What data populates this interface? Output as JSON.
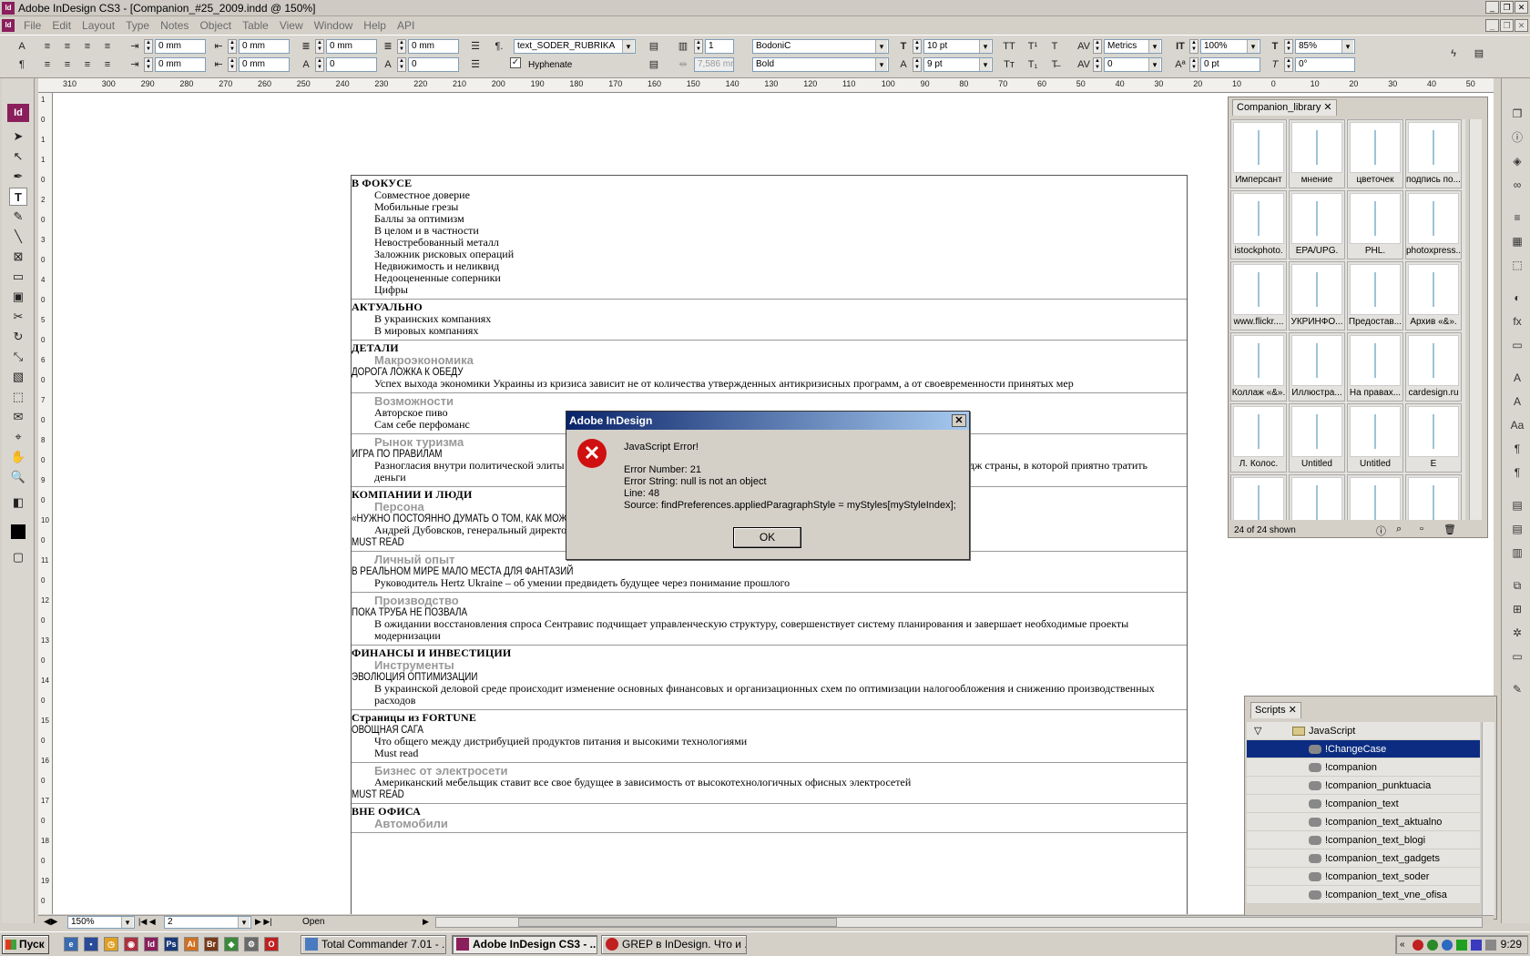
{
  "window": {
    "title": "Adobe InDesign CS3 - [Companion_#25_2009.indd @ 150%]",
    "app_icon": "Id"
  },
  "menu": [
    "File",
    "Edit",
    "Layout",
    "Type",
    "Notes",
    "Object",
    "Table",
    "View",
    "Window",
    "Help",
    "API"
  ],
  "control": {
    "indent_left": "0 mm",
    "indent_right": "0 mm",
    "first_line": "0 mm",
    "last_line": "0 mm",
    "space_before": "0 mm",
    "space_after": "0",
    "drop_lines": "0 mm",
    "drop_chars": "0",
    "paragraph_style": "text_SODER_RUBRIKA",
    "hyphenate_label": "Hyphenate",
    "columns": "1",
    "gutter": "7,586 mm",
    "font": "BodoniC",
    "style": "Bold",
    "size": "10 pt",
    "leading": "9 pt",
    "kerning": "Metrics",
    "tracking": "0",
    "vscale": "100%",
    "baseline": "0 pt",
    "hscale": "85%",
    "skew": "0°"
  },
  "ruler_h": [
    "310",
    "300",
    "290",
    "280",
    "270",
    "260",
    "250",
    "240",
    "230",
    "220",
    "210",
    "200",
    "190",
    "180",
    "170",
    "160",
    "150",
    "140",
    "130",
    "120",
    "110",
    "100",
    "90",
    "80",
    "70",
    "60",
    "50",
    "40",
    "30",
    "20",
    "10",
    "0",
    "10",
    "20",
    "30",
    "40",
    "50"
  ],
  "ruler_v": [
    "1",
    "0",
    "1",
    "1",
    "0",
    "2",
    "0",
    "3",
    "0",
    "4",
    "0",
    "5",
    "0",
    "6",
    "0",
    "7",
    "0",
    "8",
    "0",
    "9",
    "0",
    "10",
    "0",
    "11",
    "0",
    "12",
    "0",
    "13",
    "0",
    "14",
    "0",
    "15",
    "0",
    "16",
    "0",
    "17",
    "0",
    "18",
    "0",
    "19",
    "0"
  ],
  "doc": {
    "sections": [
      {
        "lines": [
          {
            "t": "В ФОКУСЕ",
            "c": "h"
          },
          {
            "t": "Совместное доверие",
            "c": "i"
          },
          {
            "t": "Мобильные грезы",
            "c": "i"
          },
          {
            "t": "Баллы за оптимизм",
            "c": "i"
          },
          {
            "t": "В целом и в частности",
            "c": "i"
          },
          {
            "t": "Невостребованный металл",
            "c": "i"
          },
          {
            "t": "Заложник рисковых операций",
            "c": "i"
          },
          {
            "t": "Недвижимость и неликвид",
            "c": "i"
          },
          {
            "t": "Недооцененные соперники",
            "c": "i"
          },
          {
            "t": "Цифры",
            "c": "i"
          }
        ]
      },
      {
        "lines": [
          {
            "t": "АКТУАЛЬНО",
            "c": "h"
          },
          {
            "t": "В украинских компаниях",
            "c": "i"
          },
          {
            "t": "В мировых компаниях",
            "c": "i"
          }
        ]
      },
      {
        "lines": [
          {
            "t": "ДЕТАЛИ",
            "c": "h"
          },
          {
            "t": "Макроэкономика",
            "c": "g"
          },
          {
            "t": "ДОРОГА ЛОЖКА К ОБЕДУ",
            "c": "c"
          },
          {
            "t": "Успех выхода экономики Украины из кризиса зависит не от количества утвержденных антикризисных программ, а от своевременности принятых мер",
            "c": "i"
          }
        ]
      },
      {
        "lines": [
          {
            "t": "Возможности",
            "c": "g"
          },
          {
            "t": "Авторское пиво",
            "c": "i"
          },
          {
            "t": "Сам себе перфоманс",
            "c": "i"
          }
        ]
      },
      {
        "lines": [
          {
            "t": "Рынок туризма",
            "c": "g"
          },
          {
            "t": "ИГРА ПО ПРАВИЛАМ",
            "c": "c"
          },
          {
            "t": "Разногласия внутри политической элиты мешают Украине выстроить общую стратегию развития туристической отрасли и имидж страны, в которой приятно тратить деньги",
            "c": "w"
          }
        ]
      },
      {
        "lines": [
          {
            "t": "КОМПАНИИ И ЛЮДИ",
            "c": "h"
          },
          {
            "t": "Персона",
            "c": "g"
          },
          {
            "t": "«НУЖНО ПОСТОЯННО ДУМАТЬ О ТОМ, КАК МОЖНО ЖИТЬ ПО-ДРУГОМУ»",
            "c": "c"
          },
          {
            "t": "Андрей Дубовсков, генеральный директор МТС-Украина",
            "c": "i"
          },
          {
            "t": "MUST READ",
            "c": "c"
          }
        ]
      },
      {
        "lines": [
          {
            "t": "Личный опыт",
            "c": "g"
          },
          {
            "t": "В РЕАЛЬНОМ МИРЕ МАЛО МЕСТА ДЛЯ ФАНТАЗИЙ",
            "c": "c"
          },
          {
            "t": "Руководитель Hertz Ukraine – об умении предвидеть будущее через понимание прошлого",
            "c": "i"
          }
        ]
      },
      {
        "lines": [
          {
            "t": "Производство",
            "c": "g"
          },
          {
            "t": "ПОКА ТРУБА НЕ ПОЗВАЛА",
            "c": "c"
          },
          {
            "t": "В ожидании восстановления спроса Сентравис подчищает управленческую структуру, совершенствует систему планирования и завершает необходимые проекты модернизации",
            "c": "w"
          }
        ]
      },
      {
        "lines": [
          {
            "t": "ФИНАНСЫ И ИНВЕСТИЦИИ",
            "c": "h"
          },
          {
            "t": "Инструменты",
            "c": "g"
          },
          {
            "t": "ЭВОЛЮЦИЯ ОПТИМИЗАЦИИ",
            "c": "c"
          },
          {
            "t": "В украинской деловой среде происходит изменение основных финансовых и организационных схем по оптимизации налогообложения и снижению производственных расходов",
            "c": "w"
          }
        ]
      },
      {
        "lines": [
          {
            "t": "Страницы из FORTUNE",
            "c": "h"
          },
          {
            "t": "ОВОЩНАЯ САГА",
            "c": "c"
          },
          {
            "t": "Что общего между дистрибуцией продуктов питания и высокими технологиями",
            "c": "i"
          },
          {
            "t": "Must read",
            "c": "i"
          }
        ]
      },
      {
        "lines": [
          {
            "t": "Бизнес от электросети",
            "c": "g"
          },
          {
            "t": "Американский мебельщик ставит все свое будущее в зависимость от высокотехнологичных офисных электросетей",
            "c": "i"
          },
          {
            "t": "MUST READ",
            "c": "c"
          }
        ]
      },
      {
        "lines": [
          {
            "t": "ВНЕ ОФИСА",
            "c": "h"
          },
          {
            "t": "Автомобили",
            "c": "g"
          }
        ]
      }
    ]
  },
  "library": {
    "title": "Companion_library",
    "shown": "24 of 24 shown",
    "items": [
      "Имперсант",
      "мнение",
      "цветочек",
      "подпись по...",
      "istockphoto.",
      "EPA/UPG.",
      "PHL.",
      "photoxpress...",
      "www.flickr....",
      "УКРИНФО...",
      "Предостав...",
      "Архив «&».",
      "Коллаж «&».",
      "Иллюстра...",
      "На правах...",
      "cardesign.ru",
      "Л. Колос.",
      "Untitled",
      "Untitled",
      "E",
      "",
      "",
      "",
      ""
    ]
  },
  "scripts": {
    "title": "Scripts",
    "folder": "JavaScript",
    "items": [
      "!ChangeCase",
      "!companion",
      "!companion_punktuacia",
      "!companion_text",
      "!companion_text_aktualno",
      "!companion_text_blogi",
      "!companion_text_gadgets",
      "!companion_text_soder",
      "!companion_text_vne_ofisa"
    ],
    "selected": 0
  },
  "dialog": {
    "title": "Adobe InDesign",
    "heading": "JavaScript Error!",
    "error_number": "Error Number: 21",
    "error_string": "Error String: null is not an object",
    "line": "Line: 48",
    "source": "Source:     findPreferences.appliedParagraphStyle = myStyles[myStyleIndex];",
    "ok": "OK"
  },
  "status": {
    "zoom": "150%",
    "page": "2",
    "state": "Open"
  },
  "taskbar": {
    "start": "Пуск",
    "tasks": [
      "Total Commander 7.01 - ...",
      "Adobe InDesign CS3 - ...",
      "GREP в InDesign. Что и ..."
    ],
    "active": 1,
    "clock": "9:29"
  },
  "colors": {
    "accent": "#0b2c80",
    "dialog_title": "#0a246a",
    "error": "#d01010",
    "indesign": "#8a1f5c"
  }
}
